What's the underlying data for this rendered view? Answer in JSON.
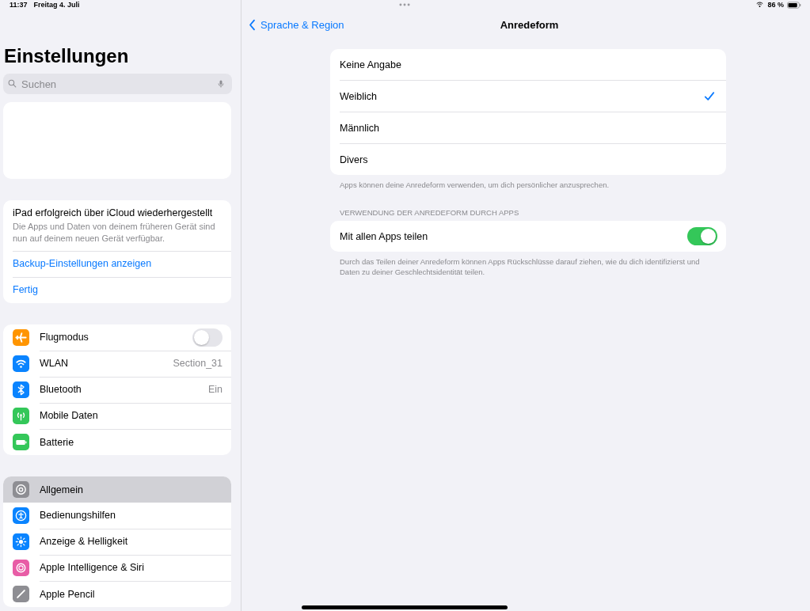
{
  "status_bar": {
    "time": "11:37",
    "date": "Freitag 4. Juli",
    "battery": "86 %"
  },
  "sidebar": {
    "title": "Einstellungen",
    "search": {
      "placeholder": "Suchen"
    },
    "notice": {
      "title": "iPad erfolgreich über iCloud wiederhergestellt",
      "text": "Die Apps und Daten von deinem früheren Gerät sind nun auf deinem neuen Gerät verfügbar.",
      "links": [
        "Backup-Einstellungen anzeigen",
        "Fertig"
      ]
    },
    "groups": [
      [
        {
          "kind": "airplane",
          "label": "Flugmodus",
          "on": false,
          "selected": false
        },
        {
          "kind": "wifi",
          "label": "WLAN",
          "value": "Section_31",
          "selected": false
        },
        {
          "kind": "bluetooth",
          "label": "Bluetooth",
          "value": "Ein",
          "selected": false
        },
        {
          "kind": "cellular",
          "label": "Mobile Daten",
          "selected": false
        },
        {
          "kind": "battery",
          "label": "Batterie",
          "selected": false
        }
      ],
      [
        {
          "kind": "general",
          "label": "Allgemein",
          "selected": true
        },
        {
          "kind": "accessibility",
          "label": "Bedienungshilfen",
          "selected": false
        },
        {
          "kind": "display",
          "label": "Anzeige & Helligkeit",
          "selected": false
        },
        {
          "kind": "siri",
          "label": "Apple Intelligence & Siri",
          "selected": false
        },
        {
          "kind": "pencil",
          "label": "Apple Pencil",
          "selected": false
        }
      ]
    ]
  },
  "detail": {
    "back": "Sprache & Region",
    "title": "Anredeform",
    "options": [
      {
        "label": "Keine Angabe",
        "selected": false
      },
      {
        "label": "Weiblich",
        "selected": true
      },
      {
        "label": "Männlich",
        "selected": false
      },
      {
        "label": "Divers",
        "selected": false
      }
    ],
    "options_footer": "Apps können deine Anredeform verwenden, um dich persönlicher anzusprechen.",
    "share_header": "VERWENDUNG DER ANREDEFORM DURCH APPS",
    "share": {
      "label": "Mit allen Apps teilen",
      "on": true
    },
    "share_footer": "Durch das Teilen deiner Anredeform können Apps Rückschlüsse darauf ziehen, wie du dich identifizierst und Daten zu deiner Geschlechtsidentität teilen."
  }
}
